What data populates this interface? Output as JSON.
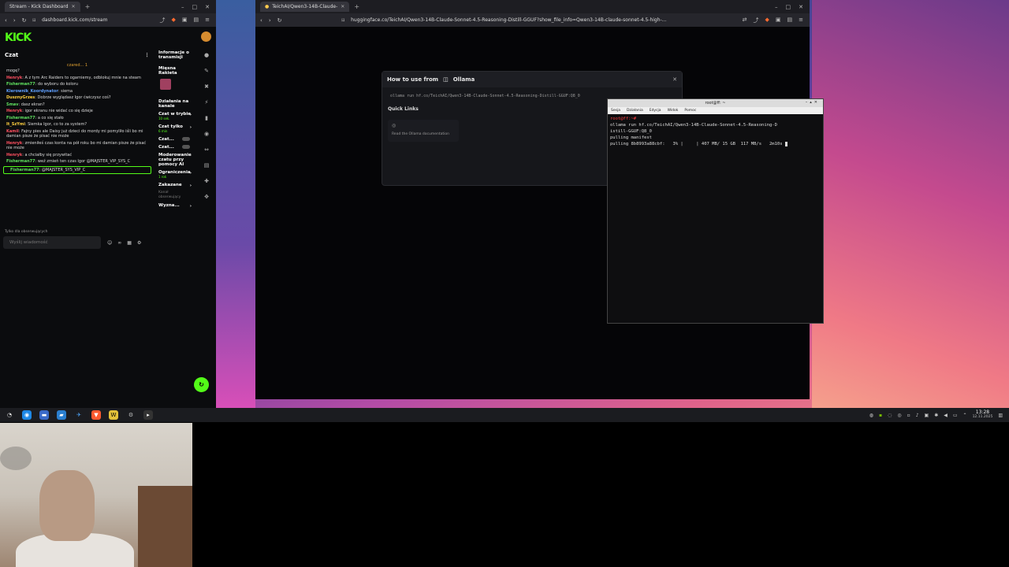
{
  "kick": {
    "tab_title": "Stream - Kick Dashboard",
    "url": "dashboard.kick.com/stream",
    "logo": "KICK",
    "chat": {
      "title": "Czat",
      "pinned": "czared... 1",
      "messages": [
        {
          "user": "",
          "text": "mogę?",
          "color": "none"
        },
        {
          "user": "Henryk",
          "text": "A z tym Arc Raiders to ogarniemy, odblokuj mnie na steam",
          "color": "red"
        },
        {
          "user": "Fisherman77",
          "text": "do wyboru do koloru",
          "color": "green"
        },
        {
          "user": "Kierownik_Koordynator",
          "text": "siema",
          "color": "blue"
        },
        {
          "user": "DusznyGrzes",
          "text": "Dobrze wyglądasz Igor ćwiczysz coś?",
          "color": "yellow"
        },
        {
          "user": "Smav",
          "text": "dasz ekran?",
          "color": "green"
        },
        {
          "user": "Henryk",
          "text": "igor ekranu nie widać co się dzieje",
          "color": "red"
        },
        {
          "user": "Fisherman77",
          "text": "a co się stało",
          "color": "green"
        },
        {
          "user": "It_SzYmi",
          "text": "Siemka Igor, co to za system?",
          "color": "yellow"
        },
        {
          "user": "Kamil",
          "text": "Fajny pies ale Daisy już dzieci do mordy mi pomyliło iśli bo mi damian pisze że pisać nie może",
          "color": "red"
        },
        {
          "user": "Henryk",
          "text": "zmieniłeś czas konta na pół roku bo mi damian pisze że pisać nie może",
          "color": "red"
        },
        {
          "user": "Henryk",
          "text": "a chciałby się przywitać",
          "color": "red"
        },
        {
          "user": "Fisherman77",
          "text": "weź zmień ten czas Igor @MAJSTER_VIP_SYS_C",
          "color": "green"
        },
        {
          "user": "Fisherman77",
          "text": "@MAJSTER_SYS_VIP_C",
          "color": "green"
        }
      ],
      "follow_note": "Tylko dla obserwujących",
      "input_placeholder": "Wyślij wiadomość"
    },
    "side": {
      "stream_info": "Informacje o transmisji",
      "channel_name": "Mięsna Rakieta",
      "actions_label": "Działania na kanale",
      "slow_mode": "Czat w trybie",
      "slow_mode_sub": "10 sek.",
      "followers_only": "Czat tylko",
      "followers_only_sub": "6 min",
      "chat_toggle_a": "Czat...",
      "chat_toggle_b": "Czat...",
      "ai_moderation": "Moderowanie czatu przy pomocy AI",
      "limits": "Ograniczenia",
      "limits_sub": "1 rok",
      "banned": "Zakazane",
      "channel_followers": "Kanał obserwujący",
      "mark": "Wyzna..."
    }
  },
  "hf": {
    "tab_title": "TeichAI/Qwen3-14B-Claude-",
    "url": "huggingface.co/TeichAI/Qwen3-14B-Claude-Sonnet-4.5-Reasoning-Distill-GGUF?show_file_info=Qwen3-14B-claude-sonnet-4.5-high-...",
    "modal": {
      "title": "How to use from",
      "tool": "Ollama",
      "command": "ollama run hf.co/TeichAI/Qwen3-14B-Claude-Sonnet-4.5-Reasoning-Distill-GGUF:Q8_0",
      "copy": "Copy",
      "quick_links_title": "Quick Links",
      "quick_link": "Read the Ollama documentation"
    }
  },
  "terminal": {
    "title": "root@ff: ~",
    "menu": [
      "Sesja",
      "Działania",
      "Edycja",
      "Widok",
      "Pomoc"
    ],
    "prompt": "root@ff:~#",
    "lines": [
      "ollama run hf.co/TeichAI/Qwen3-14B-Claude-Sonnet-4.5-Reasoning-D",
      "istill-GGUF:Q8_0",
      "pulling manifest",
      "pulling 8b8993a88cbf:   3% |     | 407 MB/ 15 GB  117 MB/s   2m10s"
    ]
  },
  "taskbar": {
    "time": "13:28",
    "date": "12.11.2025"
  },
  "colors": {
    "kick_green": "#53fc18",
    "wallpaper_mid": "#5c3f9a"
  }
}
